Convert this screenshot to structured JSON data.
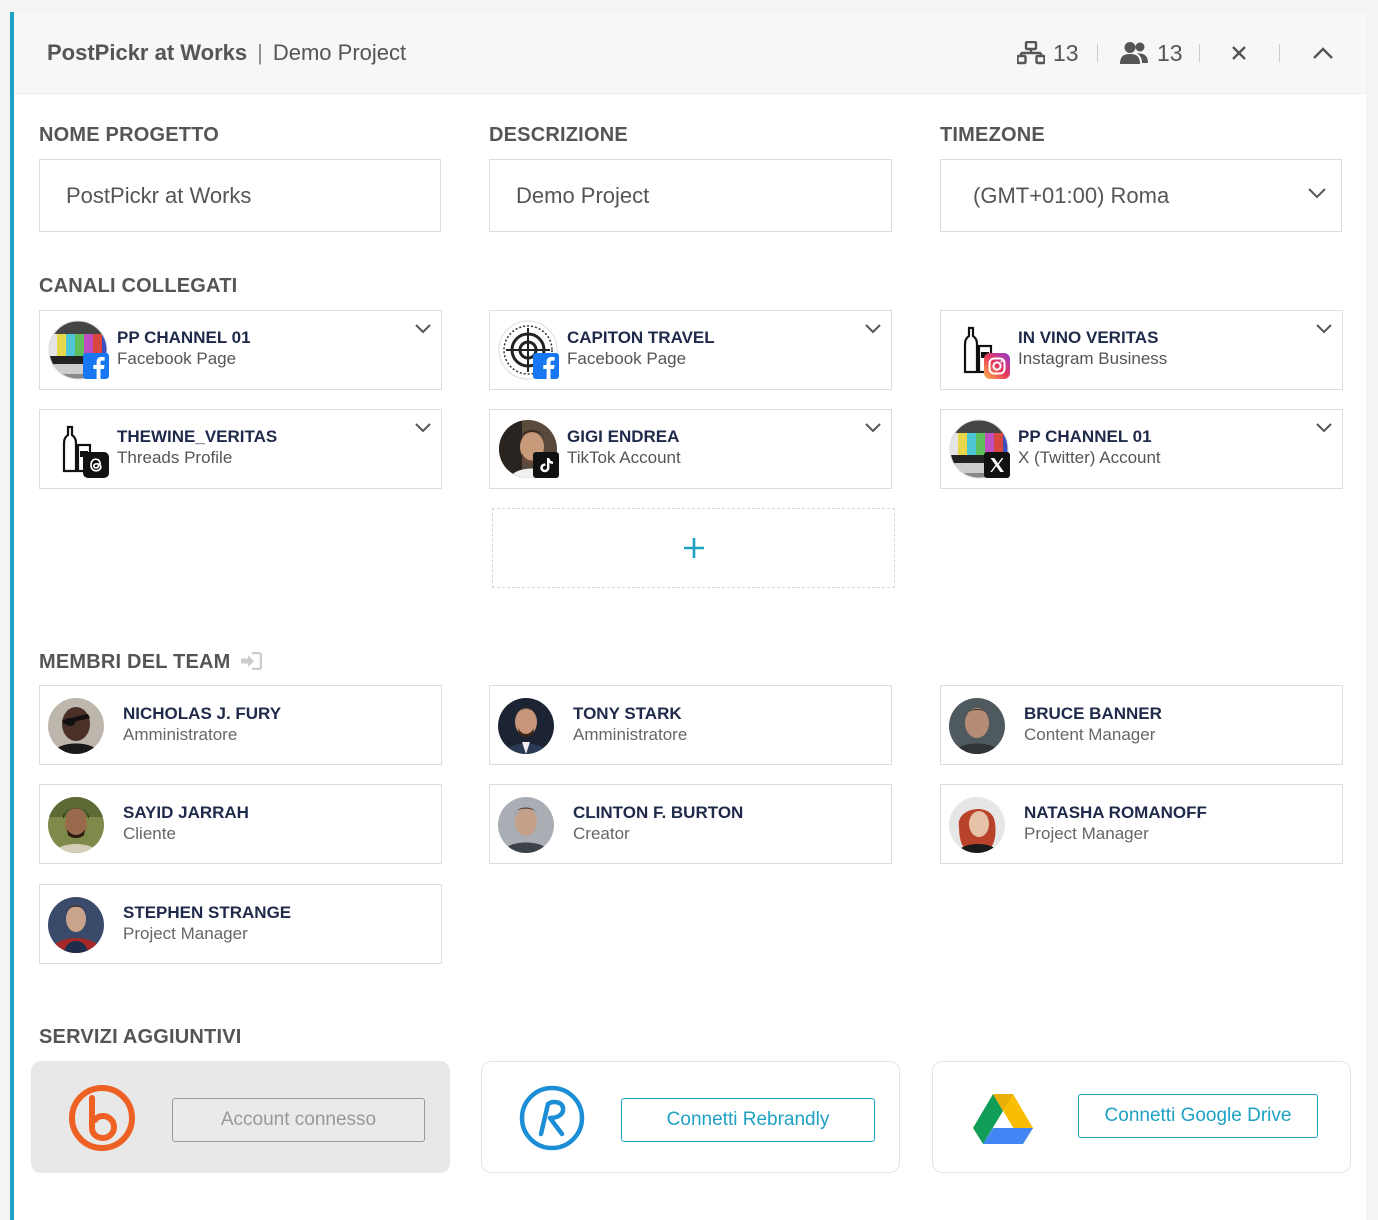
{
  "header": {
    "project_name": "PostPickr at Works",
    "separator": "|",
    "description": "Demo Project",
    "channels_count": "13",
    "members_count": "13"
  },
  "fields": {
    "name_label": "NOME PROGETTO",
    "name_value": "PostPickr at Works",
    "description_label": "DESCRIZIONE",
    "description_value": "Demo Project",
    "timezone_label": "TIMEZONE",
    "timezone_value": "(GMT+01:00) Roma"
  },
  "channels": {
    "label": "CANALI COLLEGATI",
    "items": [
      {
        "name": "PP CHANNEL 01",
        "type": "Facebook Page",
        "badge": "facebook-icon"
      },
      {
        "name": "CAPITON TRAVEL",
        "type": "Facebook Page",
        "badge": "facebook-icon"
      },
      {
        "name": "IN VINO VERITAS",
        "type": "Instagram Business",
        "badge": "instagram-icon"
      },
      {
        "name": "THEWINE_VERITAS",
        "type": "Threads Profile",
        "badge": "threads-icon"
      },
      {
        "name": "GIGI ENDREA",
        "type": "TikTok Account",
        "badge": "tiktok-icon"
      },
      {
        "name": "PP CHANNEL 01",
        "type": "X (Twitter) Account",
        "badge": "x-icon"
      }
    ],
    "add_label": "+"
  },
  "team": {
    "label": "MEMBRI DEL TEAM",
    "members": [
      {
        "name": "NICHOLAS J. FURY",
        "role": "Amministratore"
      },
      {
        "name": "TONY STARK",
        "role": "Amministratore"
      },
      {
        "name": "BRUCE BANNER",
        "role": "Content Manager"
      },
      {
        "name": "SAYID JARRAH",
        "role": "Cliente"
      },
      {
        "name": "CLINTON F. BURTON",
        "role": "Creator"
      },
      {
        "name": "NATASHA ROMANOFF",
        "role": "Project Manager"
      },
      {
        "name": "STEPHEN STRANGE",
        "role": "Project Manager"
      }
    ]
  },
  "services": {
    "label": "SERVIZI AGGIUNTIVI",
    "bitly_button": "Account connesso",
    "rebrandly_button": "Connetti Rebrandly",
    "gdrive_button": "Connetti Google Drive"
  },
  "colors": {
    "accent": "#1fa1c4",
    "name_text": "#1f2a4a",
    "label_text": "#555555"
  }
}
